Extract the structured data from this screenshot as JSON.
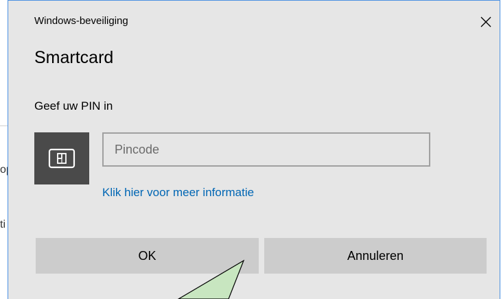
{
  "dialog": {
    "window_title": "Windows-beveiliging",
    "heading": "Smartcard",
    "prompt": "Geef uw PIN in",
    "pin_input": {
      "value": "",
      "placeholder": "Pincode"
    },
    "info_link": "Klik hier voor meer informatie",
    "ok_label": "OK",
    "cancel_label": "Annuleren",
    "icons": {
      "close": "close-icon",
      "card": "smartcard-icon"
    }
  },
  "background": {
    "fragment_1": "op",
    "fragment_2": "ti"
  },
  "colors": {
    "dialog_bg": "#e6e6e6",
    "accent_border": "#4a90e2",
    "link": "#0066b4",
    "button_bg": "#cccccc",
    "card_tile": "#4a4a4a",
    "callout_fill": "#c8e6c0"
  }
}
